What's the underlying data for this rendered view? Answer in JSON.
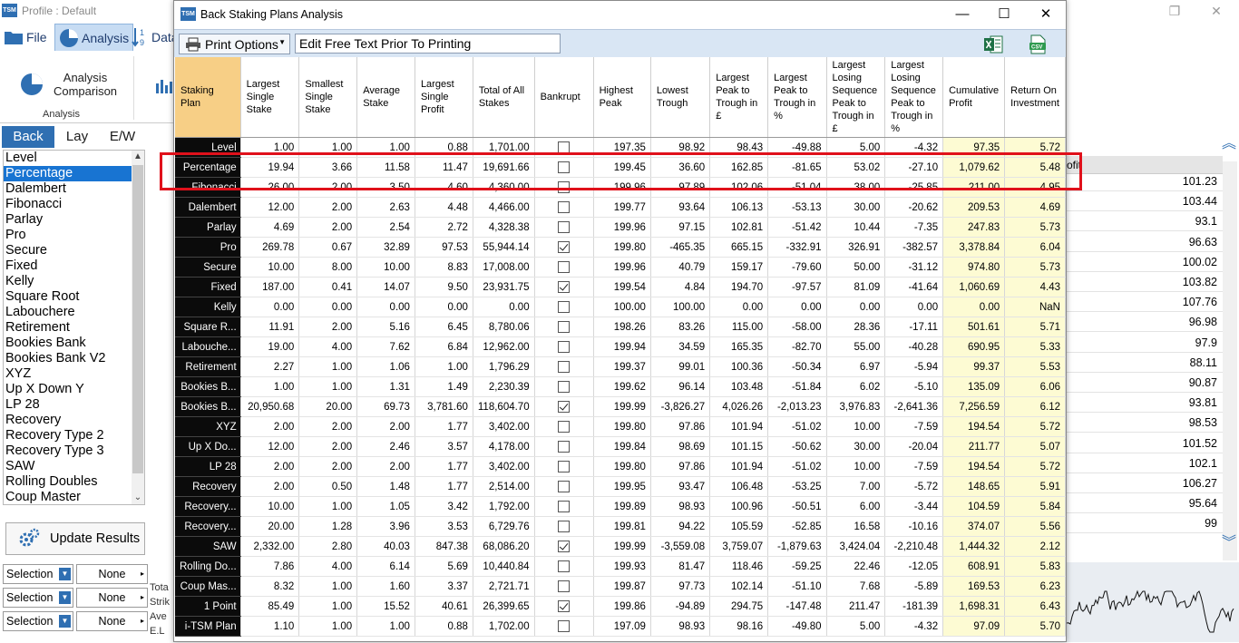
{
  "app": {
    "logo": "TSM",
    "title": "Profile : Default",
    "ribbon_tabs": [
      "File",
      "Analysis",
      "Data"
    ],
    "ribbon_button": "Analysis Comparison",
    "ribbon_group": "Analysis",
    "bet_types": [
      "Back",
      "Lay",
      "E/W"
    ],
    "plans": [
      "Level",
      "Percentage",
      "Dalembert",
      "Fibonacci",
      "Parlay",
      "Pro",
      "Secure",
      "Fixed",
      "Kelly",
      "Square Root",
      "Labouchere",
      "Retirement",
      "Bookies Bank",
      "Bookies Bank V2",
      "XYZ",
      "Up X Down Y",
      "LP 28",
      "Recovery",
      "Recovery Type 2",
      "Recovery Type 3",
      "SAW",
      "Rolling Doubles",
      "Coup Master"
    ],
    "selected_plan": "Percentage",
    "update_button": "Update Results",
    "selections": [
      {
        "label": "Selection",
        "value": "None"
      },
      {
        "label": "Selection",
        "value": "None"
      },
      {
        "label": "Selection",
        "value": "None"
      }
    ],
    "right_header": "ofit",
    "right_values": [
      "101.23",
      "103.44",
      "93.1",
      "96.63",
      "100.02",
      "103.82",
      "107.76",
      "96.98",
      "97.9",
      "88.11",
      "90.87",
      "93.81",
      "98.53",
      "101.52",
      "102.1",
      "106.27",
      "95.64",
      "99"
    ],
    "bottom_labels": [
      "Tota",
      "Strik",
      "Ave",
      "E.L"
    ]
  },
  "dialog": {
    "logo": "TSM",
    "title": "Back Staking Plans Analysis",
    "print_options": "Print Options",
    "free_text": "Edit Free Text Prior To Printing",
    "export_icons": [
      "excel-export-icon",
      "csv-export-icon"
    ],
    "columns": [
      "Staking Plan",
      "Largest Single Stake",
      "Smallest Single Stake",
      "Average Stake",
      "Largest Single Profit",
      "Total of All Stakes",
      "Bankrupt",
      "Highest Peak",
      "Lowest Trough",
      "Largest Peak to Trough in £",
      "Largest Peak to Trough in %",
      "Largest Losing Sequence Peak to Trough in £",
      "Largest Losing Sequence Peak to Trough in %",
      "Cumulative Profit",
      "Return On Investment"
    ],
    "rows": [
      [
        "Level",
        "1.00",
        "1.00",
        "1.00",
        "0.88",
        "1,701.00",
        false,
        "197.35",
        "98.92",
        "98.43",
        "-49.88",
        "5.00",
        "-4.32",
        "97.35",
        "5.72"
      ],
      [
        "Percentage",
        "19.94",
        "3.66",
        "11.58",
        "11.47",
        "19,691.66",
        false,
        "199.45",
        "36.60",
        "162.85",
        "-81.65",
        "53.02",
        "-27.10",
        "1,079.62",
        "5.48"
      ],
      [
        "Fibonacci",
        "26.00",
        "2.00",
        "3.50",
        "4.60",
        "4,360.00",
        false,
        "199.96",
        "97.89",
        "102.06",
        "-51.04",
        "38.00",
        "-25.85",
        "211.00",
        "4.95"
      ],
      [
        "Dalembert",
        "12.00",
        "2.00",
        "2.63",
        "4.48",
        "4,466.00",
        false,
        "199.77",
        "93.64",
        "106.13",
        "-53.13",
        "30.00",
        "-20.62",
        "209.53",
        "4.69"
      ],
      [
        "Parlay",
        "4.69",
        "2.00",
        "2.54",
        "2.72",
        "4,328.38",
        false,
        "199.96",
        "97.15",
        "102.81",
        "-51.42",
        "10.44",
        "-7.35",
        "247.83",
        "5.73"
      ],
      [
        "Pro",
        "269.78",
        "0.67",
        "32.89",
        "97.53",
        "55,944.14",
        true,
        "199.80",
        "-465.35",
        "665.15",
        "-332.91",
        "326.91",
        "-382.57",
        "3,378.84",
        "6.04"
      ],
      [
        "Secure",
        "10.00",
        "8.00",
        "10.00",
        "8.83",
        "17,008.00",
        false,
        "199.96",
        "40.79",
        "159.17",
        "-79.60",
        "50.00",
        "-31.12",
        "974.80",
        "5.73"
      ],
      [
        "Fixed",
        "187.00",
        "0.41",
        "14.07",
        "9.50",
        "23,931.75",
        true,
        "199.54",
        "4.84",
        "194.70",
        "-97.57",
        "81.09",
        "-41.64",
        "1,060.69",
        "4.43"
      ],
      [
        "Kelly",
        "0.00",
        "0.00",
        "0.00",
        "0.00",
        "0.00",
        false,
        "100.00",
        "100.00",
        "0.00",
        "0.00",
        "0.00",
        "0.00",
        "0.00",
        "NaN"
      ],
      [
        "Square R...",
        "11.91",
        "2.00",
        "5.16",
        "6.45",
        "8,780.06",
        false,
        "198.26",
        "83.26",
        "115.00",
        "-58.00",
        "28.36",
        "-17.11",
        "501.61",
        "5.71"
      ],
      [
        "Labouche...",
        "19.00",
        "4.00",
        "7.62",
        "6.84",
        "12,962.00",
        false,
        "199.94",
        "34.59",
        "165.35",
        "-82.70",
        "55.00",
        "-40.28",
        "690.95",
        "5.33"
      ],
      [
        "Retirement",
        "2.27",
        "1.00",
        "1.06",
        "1.00",
        "1,796.29",
        false,
        "199.37",
        "99.01",
        "100.36",
        "-50.34",
        "6.97",
        "-5.94",
        "99.37",
        "5.53"
      ],
      [
        "Bookies B...",
        "1.00",
        "1.00",
        "1.31",
        "1.49",
        "2,230.39",
        false,
        "199.62",
        "96.14",
        "103.48",
        "-51.84",
        "6.02",
        "-5.10",
        "135.09",
        "6.06"
      ],
      [
        "Bookies B...",
        "20,950.68",
        "20.00",
        "69.73",
        "3,781.60",
        "118,604.70",
        true,
        "199.99",
        "-3,826.27",
        "4,026.26",
        "-2,013.23",
        "3,976.83",
        "-2,641.36",
        "7,256.59",
        "6.12"
      ],
      [
        "XYZ",
        "2.00",
        "2.00",
        "2.00",
        "1.77",
        "3,402.00",
        false,
        "199.80",
        "97.86",
        "101.94",
        "-51.02",
        "10.00",
        "-7.59",
        "194.54",
        "5.72"
      ],
      [
        "Up X Do...",
        "12.00",
        "2.00",
        "2.46",
        "3.57",
        "4,178.00",
        false,
        "199.84",
        "98.69",
        "101.15",
        "-50.62",
        "30.00",
        "-20.04",
        "211.77",
        "5.07"
      ],
      [
        "LP 28",
        "2.00",
        "2.00",
        "2.00",
        "1.77",
        "3,402.00",
        false,
        "199.80",
        "97.86",
        "101.94",
        "-51.02",
        "10.00",
        "-7.59",
        "194.54",
        "5.72"
      ],
      [
        "Recovery",
        "2.00",
        "0.50",
        "1.48",
        "1.77",
        "2,514.00",
        false,
        "199.95",
        "93.47",
        "106.48",
        "-53.25",
        "7.00",
        "-5.72",
        "148.65",
        "5.91"
      ],
      [
        "Recovery...",
        "10.00",
        "1.00",
        "1.05",
        "3.42",
        "1,792.00",
        false,
        "199.89",
        "98.93",
        "100.96",
        "-50.51",
        "6.00",
        "-3.44",
        "104.59",
        "5.84"
      ],
      [
        "Recovery...",
        "20.00",
        "1.28",
        "3.96",
        "3.53",
        "6,729.76",
        false,
        "199.81",
        "94.22",
        "105.59",
        "-52.85",
        "16.58",
        "-10.16",
        "374.07",
        "5.56"
      ],
      [
        "SAW",
        "2,332.00",
        "2.80",
        "40.03",
        "847.38",
        "68,086.20",
        true,
        "199.99",
        "-3,559.08",
        "3,759.07",
        "-1,879.63",
        "3,424.04",
        "-2,210.48",
        "1,444.32",
        "2.12"
      ],
      [
        "Rolling Do...",
        "7.86",
        "4.00",
        "6.14",
        "5.69",
        "10,440.84",
        false,
        "199.93",
        "81.47",
        "118.46",
        "-59.25",
        "22.46",
        "-12.05",
        "608.91",
        "5.83"
      ],
      [
        "Coup Mas...",
        "8.32",
        "1.00",
        "1.60",
        "3.37",
        "2,721.71",
        false,
        "199.87",
        "97.73",
        "102.14",
        "-51.10",
        "7.68",
        "-5.89",
        "169.53",
        "6.23"
      ],
      [
        "1 Point",
        "85.49",
        "1.00",
        "15.52",
        "40.61",
        "26,399.65",
        true,
        "199.86",
        "-94.89",
        "294.75",
        "-147.48",
        "211.47",
        "-181.39",
        "1,698.31",
        "6.43"
      ],
      [
        "i-TSM Plan",
        "1.10",
        "1.00",
        "1.00",
        "0.88",
        "1,702.00",
        false,
        "197.09",
        "98.93",
        "98.16",
        "-49.80",
        "5.00",
        "-4.32",
        "97.09",
        "5.70"
      ]
    ],
    "highlighted_row": "Percentage",
    "colors": {
      "plan_header": "#f7cf86",
      "plan_cell": "#0b0b0b",
      "yellow_cell": "#fdfbd3",
      "highlight_box": "#e0111b",
      "toolbar": "#d9e6f4",
      "accent": "#2f6fb2"
    }
  }
}
